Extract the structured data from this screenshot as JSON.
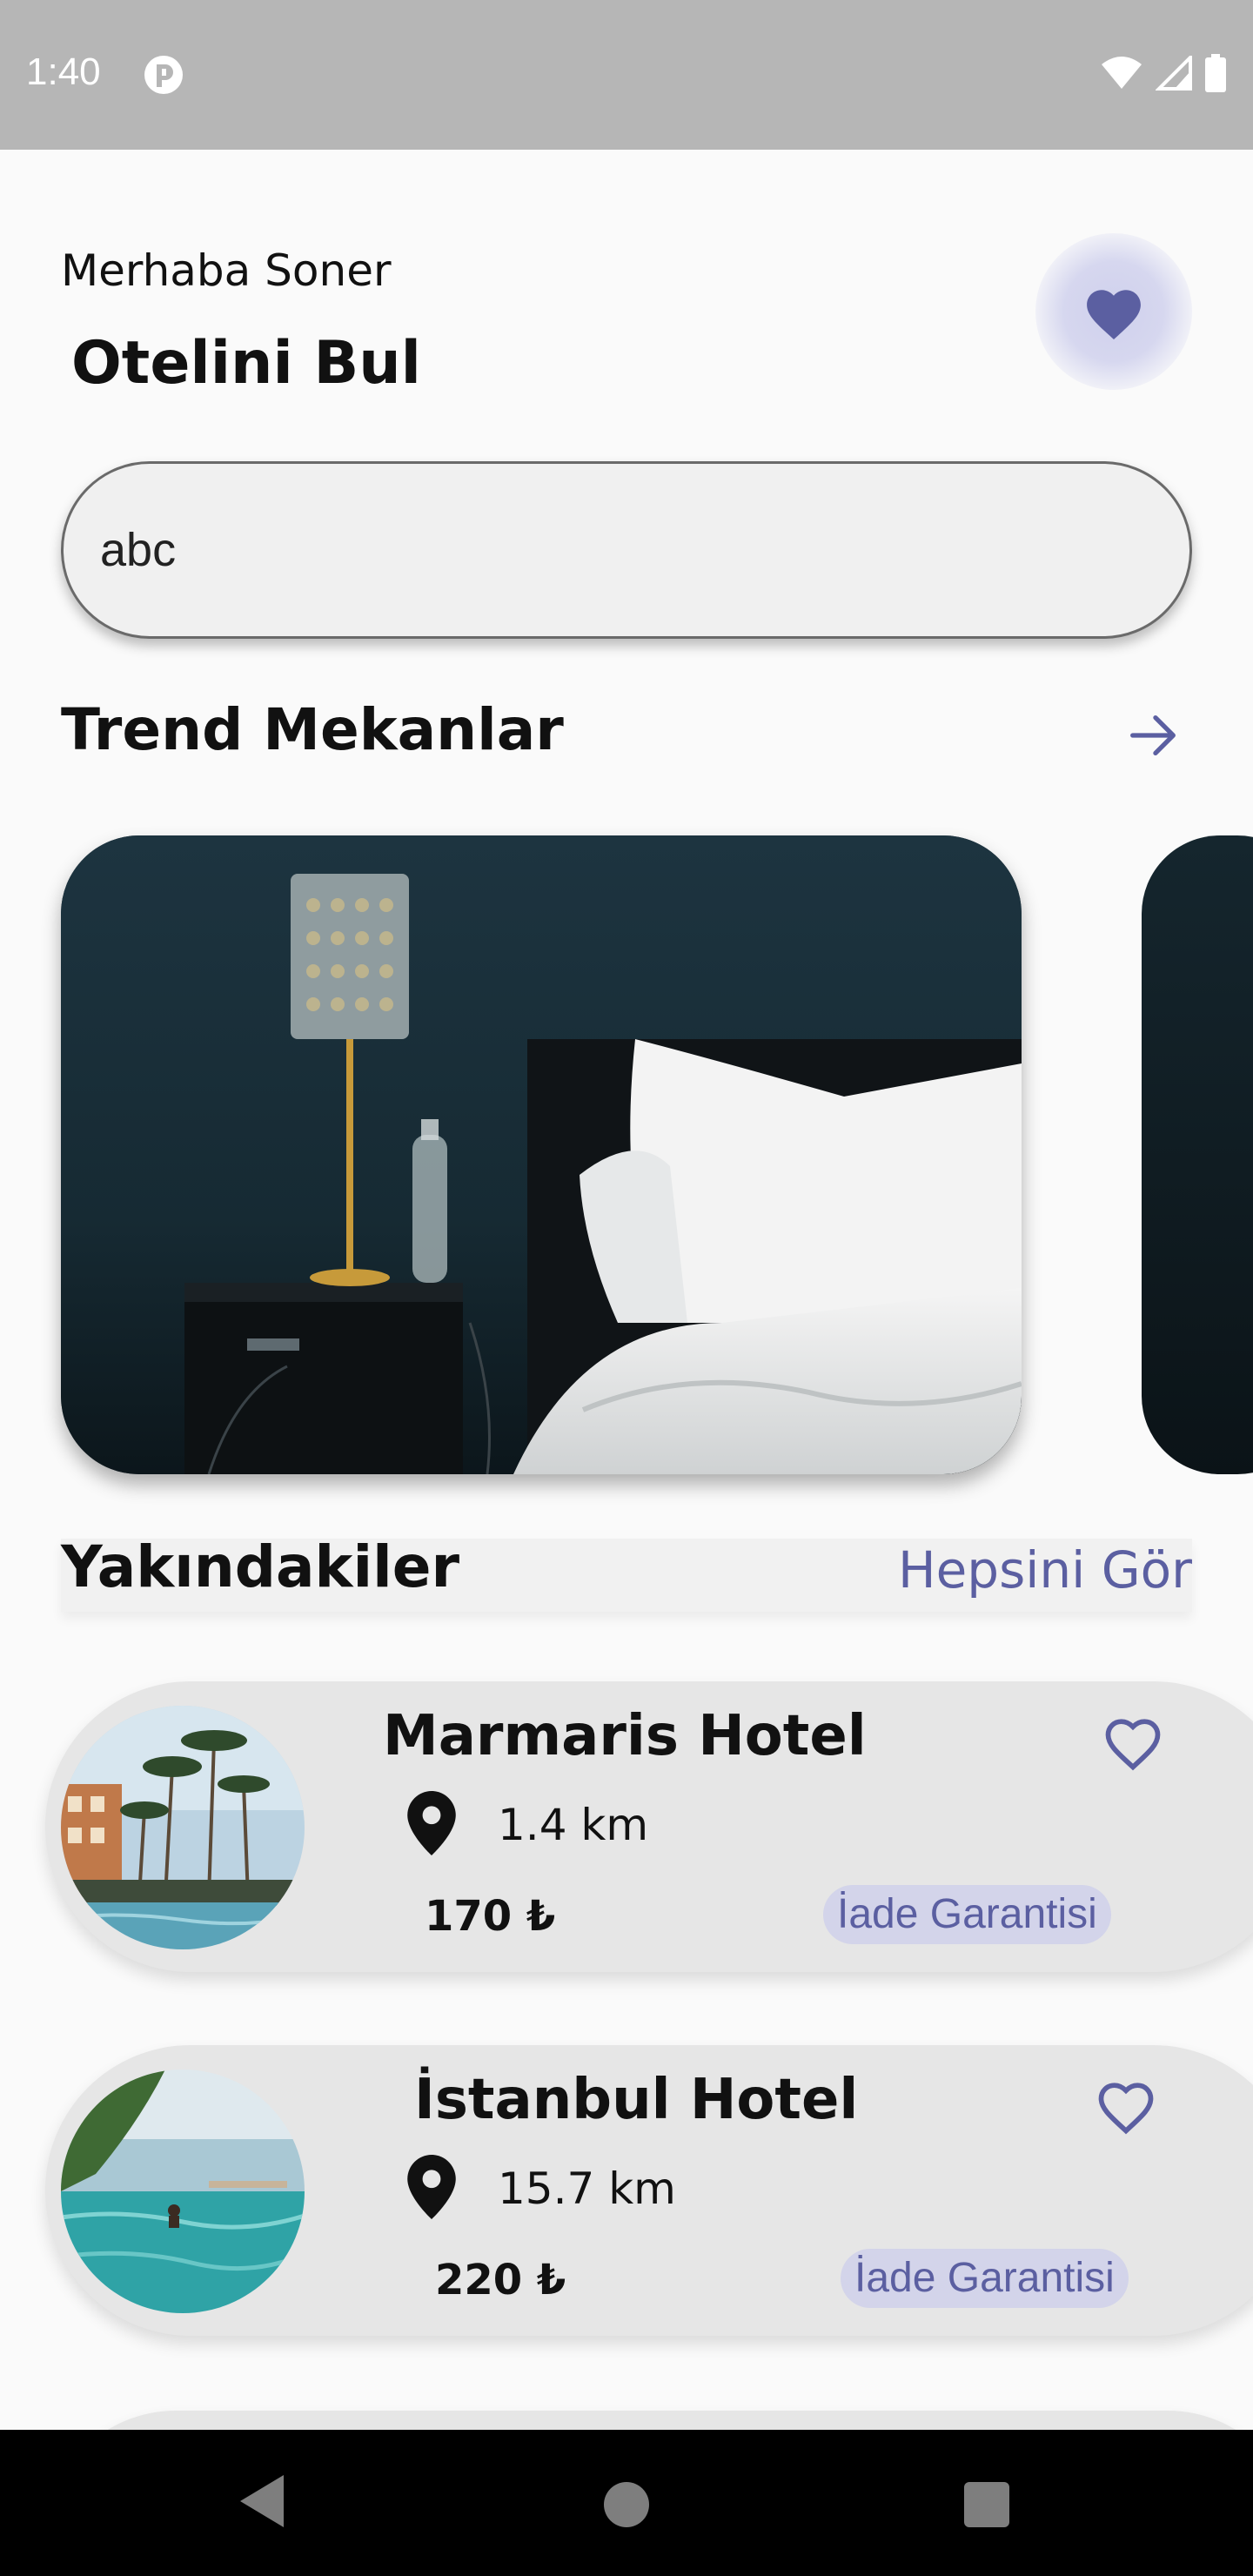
{
  "status_bar": {
    "time": "1:40"
  },
  "header": {
    "greeting": "Merhaba Soner",
    "title": "Otelini Bul",
    "favorites_icon": "heart-filled-icon"
  },
  "search": {
    "value": "abc"
  },
  "trending": {
    "title": "Trend Mekanlar",
    "see_all_icon": "arrow-right-icon"
  },
  "nearby": {
    "title": "Yakındakiler",
    "see_all_label": "Hepsini Gör",
    "hotels": [
      {
        "name": "Marmaris Hotel",
        "distance": "1.4 km",
        "price": "170 ₺",
        "badge": "İade Garantisi"
      },
      {
        "name": "İstanbul Hotel",
        "distance": "15.7 km",
        "price": "220 ₺",
        "badge": "İade Garantisi"
      }
    ]
  },
  "colors": {
    "accent": "#5b5fa1",
    "badge_bg": "#d3d4ea",
    "card_bg": "#e6e6e6",
    "status_bar": "#b6b6b6"
  }
}
